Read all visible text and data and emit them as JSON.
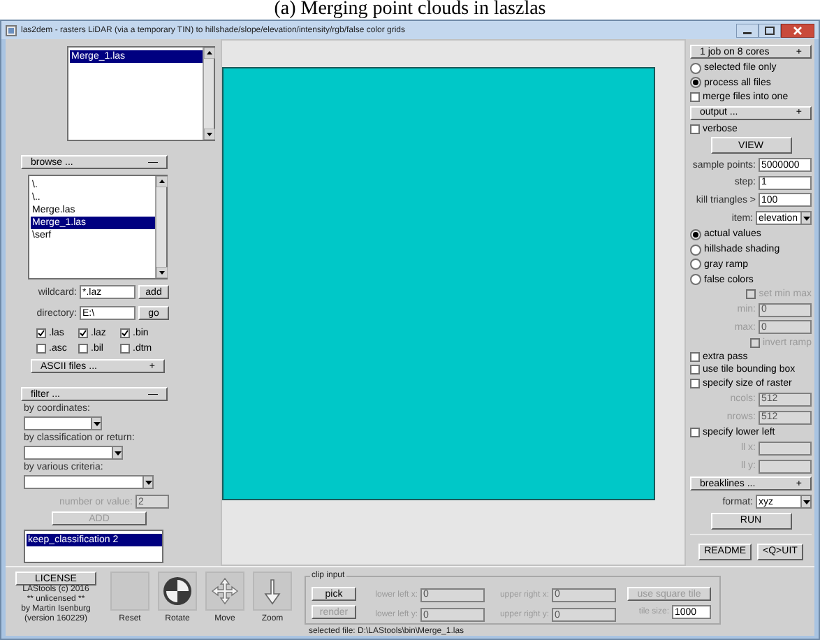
{
  "caption": "(a) Merging point clouds in laszlas",
  "window": {
    "title": "las2dem - rasters LiDAR (via a temporary TIN) to hillshade/slope/elevation/intensity/rgb/false color grids"
  },
  "selected_files": [
    {
      "label": "Merge_1.las",
      "selected": true
    }
  ],
  "browse": {
    "label": "browse ...",
    "sign": "—"
  },
  "file_list": [
    {
      "label": "\\.",
      "selected": false
    },
    {
      "label": "\\..",
      "selected": false
    },
    {
      "label": "Merge.las",
      "selected": false
    },
    {
      "label": "Merge_1.las",
      "selected": true
    },
    {
      "label": "\\serf",
      "selected": false
    }
  ],
  "wildcard": {
    "label": "wildcard:",
    "value": "*.laz",
    "button": "add"
  },
  "directory": {
    "label": "directory:",
    "value": "E:\\",
    "button": "go"
  },
  "extensions": [
    {
      "label": ".las",
      "checked": true
    },
    {
      "label": ".laz",
      "checked": true
    },
    {
      "label": ".bin",
      "checked": true
    },
    {
      "label": ".asc",
      "checked": false
    },
    {
      "label": ".bil",
      "checked": false
    },
    {
      "label": ".dtm",
      "checked": false
    }
  ],
  "ascii": {
    "label": "ASCII files ...",
    "sign": "+"
  },
  "filter": {
    "label": "filter ...",
    "sign": "—",
    "sections": [
      {
        "label": "by coordinates:"
      },
      {
        "label": "by classification or return:"
      },
      {
        "label": "by various criteria:"
      }
    ],
    "number": {
      "label": "number or value:",
      "value": "2",
      "disabled": true
    },
    "add": {
      "label": "ADD",
      "disabled": true
    },
    "list": [
      {
        "label": "keep_classification 2",
        "selected": true
      }
    ]
  },
  "license": {
    "button": "LICENSE",
    "lines": [
      "LAStools (c) 2016",
      "** unlicensed **",
      "by Martin Isenburg",
      "(version 160229)"
    ]
  },
  "tools": [
    {
      "kind": "blank",
      "label": "Reset"
    },
    {
      "kind": "globe",
      "label": "Rotate"
    },
    {
      "kind": "move",
      "label": "Move"
    },
    {
      "kind": "zoom",
      "label": "Zoom"
    }
  ],
  "clip": {
    "title": "clip input",
    "buttons": [
      {
        "label": "pick",
        "disabled": false
      },
      {
        "label": "render",
        "disabled": true
      }
    ],
    "fields": [
      {
        "label": "lower left x:",
        "value": "0"
      },
      {
        "label": "upper right x:",
        "value": "0"
      },
      {
        "label": "lower left y:",
        "value": "0"
      },
      {
        "label": "upper right y:",
        "value": "0"
      }
    ],
    "square": {
      "label": "use square tile",
      "disabled": true
    },
    "tile_size": {
      "label": "tile size:",
      "value": "1000"
    }
  },
  "status": "selected file: D:\\LAStools\\bin\\Merge_1.las",
  "right": [
    {
      "kind": "dropdown",
      "label": "1 job on 8 cores",
      "sign": "+"
    },
    {
      "kind": "radio",
      "label": "selected file only",
      "selected": false
    },
    {
      "kind": "radio",
      "label": "process all files",
      "selected": true
    },
    {
      "kind": "checkbox",
      "label": "merge files into one",
      "checked": false,
      "disabled": false
    },
    {
      "kind": "dropdown",
      "label": "output ...",
      "sign": "+"
    },
    {
      "kind": "checkbox",
      "label": "verbose",
      "checked": false,
      "disabled": false
    },
    {
      "kind": "button",
      "label": "VIEW"
    },
    {
      "kind": "field",
      "label": "sample points:",
      "value": "5000000",
      "disabled": false
    },
    {
      "kind": "field",
      "label": "step:",
      "value": "1",
      "disabled": false
    },
    {
      "kind": "field",
      "label": "kill triangles >",
      "value": "100",
      "disabled": false
    },
    {
      "kind": "combo",
      "label": "item:",
      "value": "elevation"
    },
    {
      "kind": "radio",
      "label": "actual values",
      "selected": true
    },
    {
      "kind": "radio",
      "label": "hillshade shading",
      "selected": false
    },
    {
      "kind": "radio",
      "label": "gray ramp",
      "selected": false
    },
    {
      "kind": "radio",
      "label": "false colors",
      "selected": false
    },
    {
      "kind": "checkbox",
      "label": "set min max",
      "checked": false,
      "disabled": true
    },
    {
      "kind": "field",
      "label": "min:",
      "value": "0",
      "disabled": true
    },
    {
      "kind": "field",
      "label": "max:",
      "value": "0",
      "disabled": true
    },
    {
      "kind": "checkbox",
      "label": "invert ramp",
      "checked": false,
      "disabled": true
    },
    {
      "kind": "checkbox",
      "label": "extra pass",
      "checked": false,
      "disabled": false
    },
    {
      "kind": "checkbox",
      "label": "use tile bounding box",
      "checked": false,
      "disabled": false
    },
    {
      "kind": "checkbox",
      "label": "specify size of raster",
      "checked": false,
      "disabled": false
    },
    {
      "kind": "field",
      "label": "ncols:",
      "value": "512",
      "disabled": true
    },
    {
      "kind": "field",
      "label": "nrows:",
      "value": "512",
      "disabled": true
    },
    {
      "kind": "checkbox",
      "label": "specify lower left",
      "checked": false,
      "disabled": false
    },
    {
      "kind": "field",
      "label": "ll x:",
      "disabled": true
    },
    {
      "kind": "field",
      "label": "ll y:",
      "disabled": true
    },
    {
      "kind": "dropdown",
      "label": "breaklines ...",
      "sign": "+"
    },
    {
      "kind": "combo",
      "label": "format:",
      "value": "xyz"
    },
    {
      "kind": "button",
      "label": "RUN"
    },
    {
      "kind": "buttons",
      "labels": [
        "README",
        "<Q>UIT"
      ]
    }
  ]
}
